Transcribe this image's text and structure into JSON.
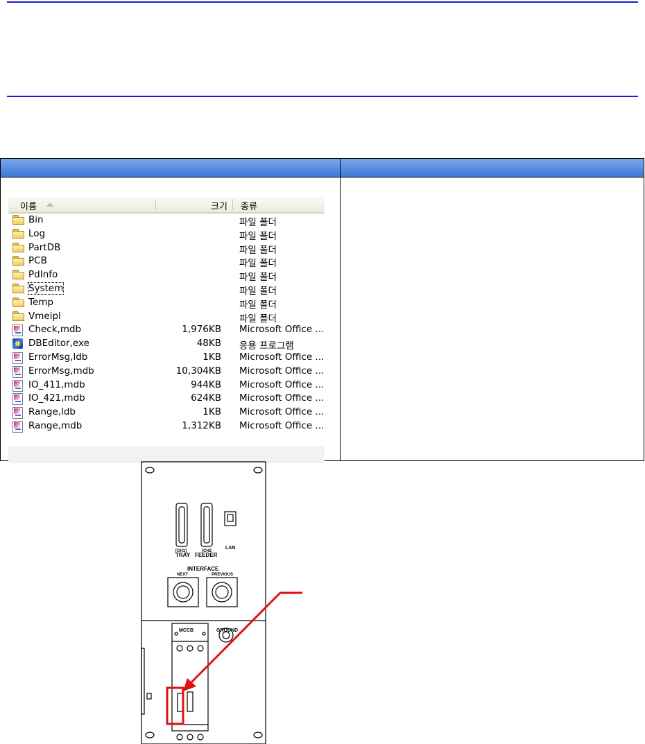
{
  "header_rule_color": "#1a1ad8",
  "table_header_color": "#4a86e0",
  "explorer": {
    "columns": {
      "name": "이름",
      "size": "크기",
      "type": "종류"
    },
    "rows": [
      {
        "icon": "folder-icon",
        "name": "Bin",
        "size": "",
        "type": "파일 폴더"
      },
      {
        "icon": "folder-icon",
        "name": "Log",
        "size": "",
        "type": "파일 폴더"
      },
      {
        "icon": "folder-icon",
        "name": "PartDB",
        "size": "",
        "type": "파일 폴더"
      },
      {
        "icon": "folder-icon",
        "name": "PCB",
        "size": "",
        "type": "파일 폴더"
      },
      {
        "icon": "folder-icon",
        "name": "PdInfo",
        "size": "",
        "type": "파일 폴더"
      },
      {
        "icon": "folder-icon",
        "name": "System",
        "size": "",
        "type": "파일 폴더",
        "selected": true
      },
      {
        "icon": "folder-icon",
        "name": "Temp",
        "size": "",
        "type": "파일 폴더"
      },
      {
        "icon": "folder-icon",
        "name": "Vmeipl",
        "size": "",
        "type": "파일 폴더"
      },
      {
        "icon": "access-db-icon",
        "name": "Check,mdb",
        "size": "1,976KB",
        "type": "Microsoft Office ..."
      },
      {
        "icon": "exe-app-icon",
        "name": "DBEditor,exe",
        "size": "48KB",
        "type": "응용 프로그램"
      },
      {
        "icon": "access-db-icon",
        "name": "ErrorMsg,ldb",
        "size": "1KB",
        "type": "Microsoft Office ..."
      },
      {
        "icon": "access-db-icon",
        "name": "ErrorMsg,mdb",
        "size": "10,304KB",
        "type": "Microsoft Office ..."
      },
      {
        "icon": "access-db-icon",
        "name": "IO_411,mdb",
        "size": "944KB",
        "type": "Microsoft Office ..."
      },
      {
        "icon": "access-db-icon",
        "name": "IO_421,mdb",
        "size": "624KB",
        "type": "Microsoft Office ..."
      },
      {
        "icon": "access-db-icon",
        "name": "Range,ldb",
        "size": "1KB",
        "type": "Microsoft Office ..."
      },
      {
        "icon": "access-db-icon",
        "name": "Range,mdb",
        "size": "1,312KB",
        "type": "Microsoft Office ..."
      }
    ]
  },
  "panel": {
    "ch1_label": "[CH1]",
    "tray_label": "TRAY",
    "ch2_label": "[CH2",
    "feeder_label": "FEEDER",
    "lan_label": "LAN",
    "interface_label": "INTERFACE",
    "next_label": "NEXT",
    "previous_label": "PREVIOUS",
    "mccb_label": "MCCB",
    "ground_label": "GROUND",
    "highlight_color": "#e01010"
  }
}
